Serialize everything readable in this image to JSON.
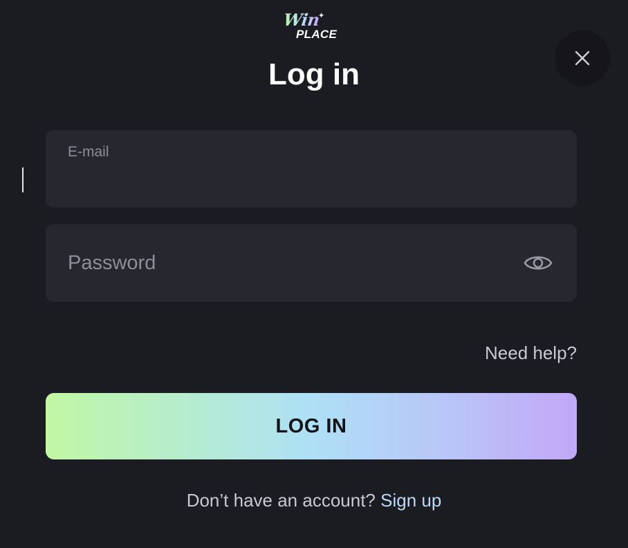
{
  "brand": {
    "logo_top": "Win",
    "logo_bottom": "PLACE"
  },
  "modal": {
    "title": "Log in"
  },
  "form": {
    "email": {
      "label": "E-mail",
      "value": ""
    },
    "password": {
      "placeholder": "Password",
      "value": ""
    },
    "need_help": "Need help?",
    "submit_label": "LOG IN"
  },
  "footer": {
    "prompt": "Don’t have an account?",
    "signup_link": "Sign up"
  },
  "icons": {
    "close": "close-icon",
    "toggle_password": "eye-icon",
    "sparkle": "sparkle-icon"
  },
  "colors": {
    "background": "#1b1b22",
    "field_background": "#272730",
    "close_background": "#15151a",
    "gradient_start": "#c2f7a4",
    "gradient_mid": "#aee0f6",
    "gradient_end": "#c3a7f7",
    "link": "#b9d9f6"
  }
}
